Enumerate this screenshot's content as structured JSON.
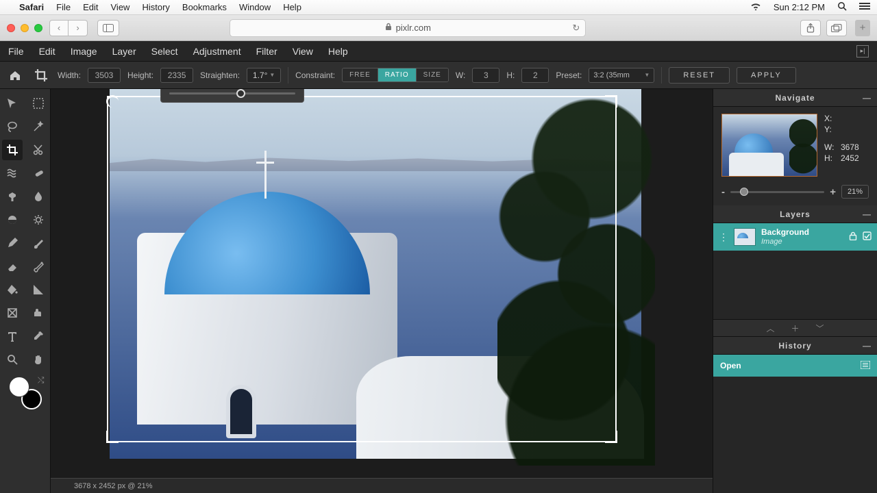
{
  "mac_menu": {
    "app": "Safari",
    "items": [
      "File",
      "Edit",
      "View",
      "History",
      "Bookmarks",
      "Window",
      "Help"
    ],
    "clock": "Sun 2:12 PM"
  },
  "browser": {
    "url": "pixlr.com"
  },
  "app_menu": [
    "File",
    "Edit",
    "Image",
    "Layer",
    "Select",
    "Adjustment",
    "Filter",
    "View",
    "Help"
  ],
  "options": {
    "width_label": "Width:",
    "width_value": "3503",
    "height_label": "Height:",
    "height_value": "2335",
    "straighten_label": "Straighten:",
    "straighten_value": "1.7°",
    "constraint_label": "Constraint:",
    "constraint_free": "FREE",
    "constraint_ratio": "RATIO",
    "constraint_size": "SIZE",
    "w_label": "W:",
    "w_value": "3",
    "h_label": "H:",
    "h_value": "2",
    "preset_label": "Preset:",
    "preset_value": "3:2 (35mm",
    "reset": "RESET",
    "apply": "APPLY"
  },
  "panels": {
    "navigate": {
      "title": "Navigate",
      "x_label": "X:",
      "y_label": "Y:",
      "w_label": "W:",
      "w_value": "3678",
      "h_label": "H:",
      "h_value": "2452",
      "zoom": "21%"
    },
    "layers": {
      "title": "Layers",
      "item_title": "Background",
      "item_sub": "Image"
    },
    "history": {
      "title": "History",
      "item": "Open"
    }
  },
  "status": "3678 x 2452 px @ 21%"
}
